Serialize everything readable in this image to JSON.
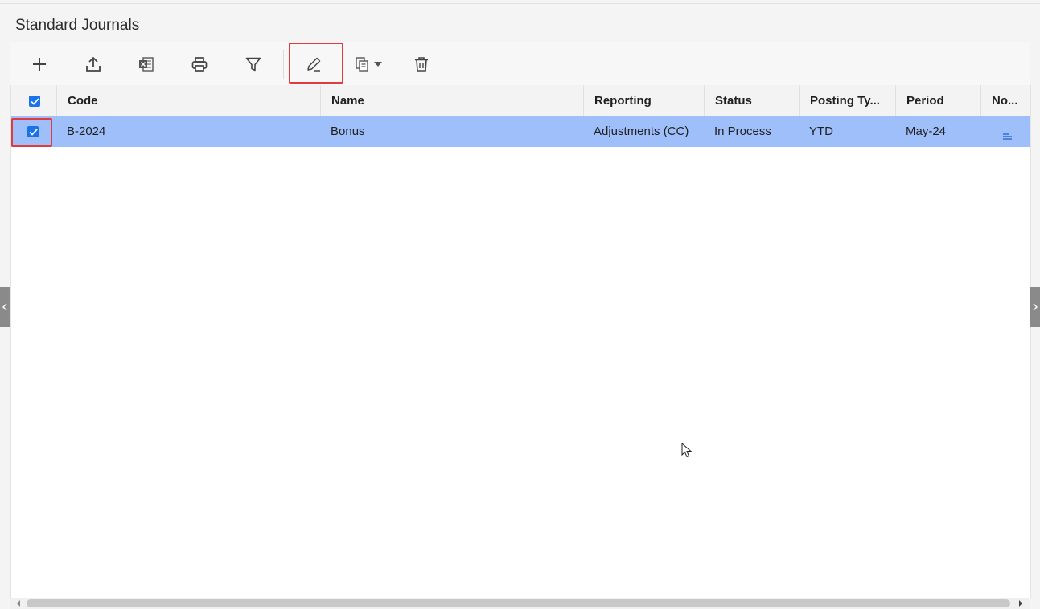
{
  "page": {
    "title": "Standard Journals"
  },
  "toolbar": {
    "buttons": [
      {
        "icon": "plus-icon",
        "label": "Add"
      },
      {
        "icon": "upload-icon",
        "label": "Upload"
      },
      {
        "icon": "excel-icon",
        "label": "Export to Excel"
      },
      {
        "icon": "print-icon",
        "label": "Print"
      },
      {
        "icon": "filter-icon",
        "label": "Filter"
      },
      {
        "icon": "pencil-icon",
        "label": "Edit"
      },
      {
        "icon": "copy-icon",
        "label": "Copy"
      },
      {
        "icon": "trash-icon",
        "label": "Delete"
      }
    ]
  },
  "grid": {
    "columns": [
      "Code",
      "Name",
      "Reporting",
      "Status",
      "Posting Ty...",
      "Period",
      "No..."
    ],
    "rows": [
      {
        "selected": true,
        "code": "B-2024",
        "name": "Bonus",
        "reporting": "Adjustments (CC)",
        "status": "In Process",
        "posting_type": "YTD",
        "period": "May-24",
        "notes_icon": "notes-icon"
      }
    ]
  },
  "colors": {
    "selected_row": "#9fbffb",
    "checkbox": "#1a73e8",
    "highlight": "#e0393e"
  }
}
